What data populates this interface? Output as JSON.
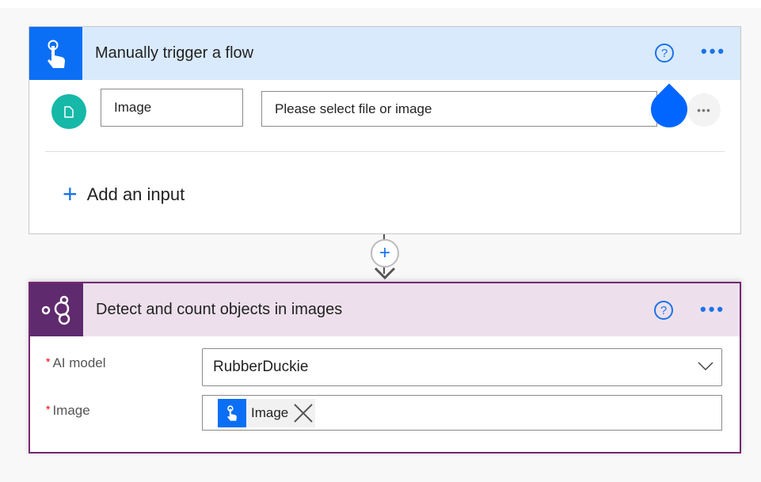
{
  "trigger_card": {
    "title": "Manually trigger a flow",
    "help_icon": "question-circle-icon",
    "more_label": "•••",
    "input_name": "Image",
    "input_placeholder": "Please select file or image",
    "input_more": "•••",
    "add_input_label": "Add an input",
    "accent_color": "#0a6ff5"
  },
  "connector": {
    "add_step": "+"
  },
  "action_card": {
    "title": "Detect and count objects in images",
    "more_label": "•••",
    "fields": [
      {
        "label": "AI model",
        "required": "*",
        "value": "RubberDuckie"
      },
      {
        "label": "Image",
        "required": "*",
        "token": "Image"
      }
    ],
    "accent_color": "#742774"
  }
}
